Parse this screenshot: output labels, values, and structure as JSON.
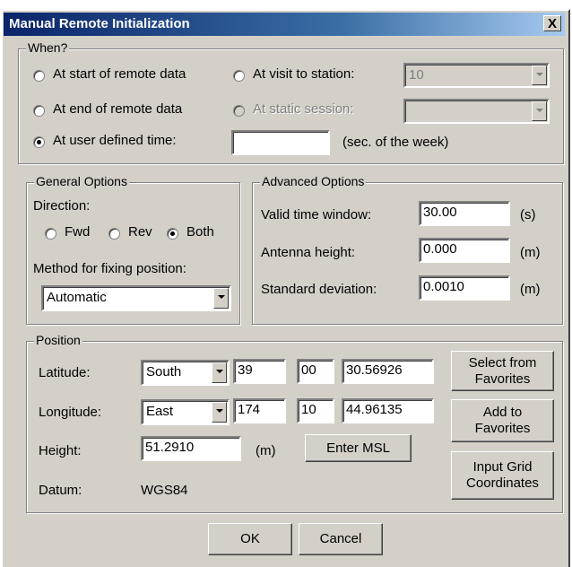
{
  "window": {
    "title": "Manual Remote Initialization",
    "close_label": "X"
  },
  "when": {
    "legend": "When?",
    "start_remote": "At start of remote data",
    "end_remote": "At end of remote data",
    "user_time": "At user defined time:",
    "visit_station": "At visit to station:",
    "static_session": "At static session:",
    "visit_station_value": "10",
    "static_session_value": "",
    "user_time_value": "",
    "user_time_unit": "(sec. of the week)",
    "selected": "user_time"
  },
  "general": {
    "legend": "General Options",
    "direction_label": "Direction:",
    "fwd": "Fwd",
    "rev": "Rev",
    "both": "Both",
    "direction_selected": "both",
    "method_label": "Method for fixing position:",
    "method_value": "Automatic"
  },
  "advanced": {
    "legend": "Advanced Options",
    "valid_window_label": "Valid time window:",
    "valid_window_value": "30.00",
    "valid_window_unit": "(s)",
    "antenna_label": "Antenna height:",
    "antenna_value": "0.000",
    "antenna_unit": "(m)",
    "stddev_label": "Standard deviation:",
    "stddev_value": "0.0010",
    "stddev_unit": "(m)"
  },
  "position": {
    "legend": "Position",
    "latitude_label": "Latitude:",
    "lat_hemisphere": "South",
    "lat_deg": "39",
    "lat_min": "00",
    "lat_sec": "30.56926",
    "longitude_label": "Longitude:",
    "lon_hemisphere": "East",
    "lon_deg": "174",
    "lon_min": "10",
    "lon_sec": "44.96135",
    "height_label": "Height:",
    "height_value": "51.2910",
    "height_unit": "(m)",
    "enter_msl": "Enter MSL",
    "datum_label": "Datum:",
    "datum_value": "WGS84",
    "select_favorites_1": "Select from",
    "select_favorites_2": "Favorites",
    "add_favorites_1": "Add to",
    "add_favorites_2": "Favorites",
    "input_grid_1": "Input Grid",
    "input_grid_2": "Coordinates"
  },
  "buttons": {
    "ok": "OK",
    "cancel": "Cancel"
  }
}
